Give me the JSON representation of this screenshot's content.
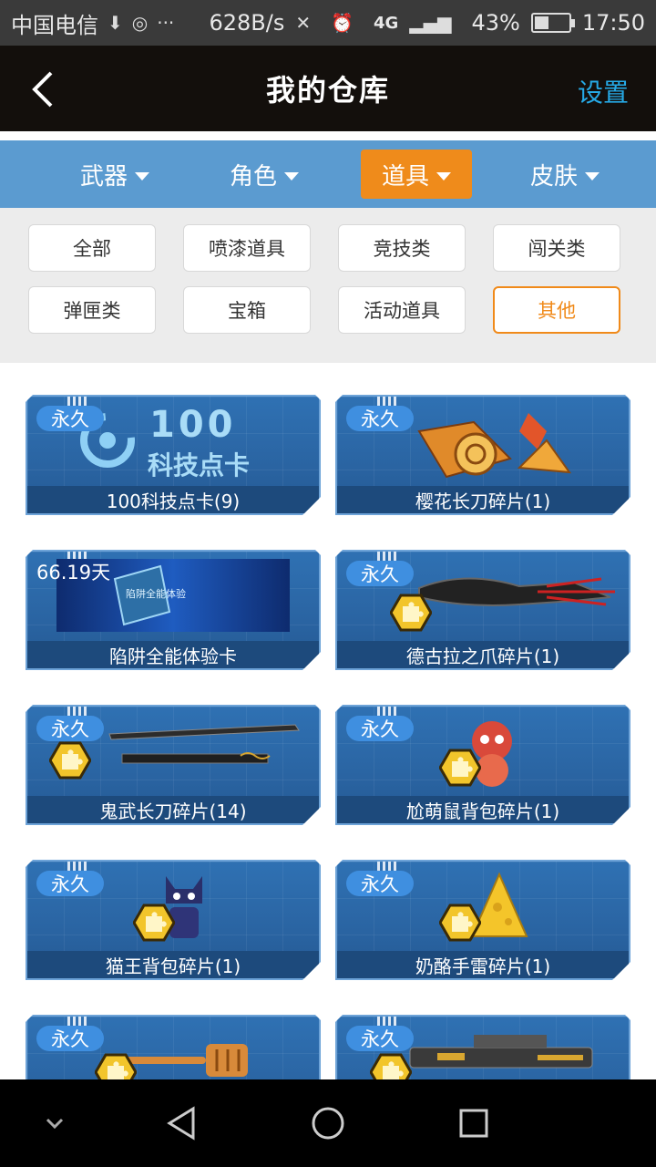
{
  "status_bar": {
    "carrier": "中国电信",
    "speed": "628B/s",
    "network": "4G",
    "battery": "43%",
    "battery_level": 0.43,
    "time": "17:50"
  },
  "header": {
    "title": "我的仓库",
    "settings_label": "设置"
  },
  "categories": [
    {
      "label": "武器",
      "active": false
    },
    {
      "label": "角色",
      "active": false
    },
    {
      "label": "道具",
      "active": true
    },
    {
      "label": "皮肤",
      "active": false
    }
  ],
  "filters": [
    {
      "label": "全部",
      "active": false
    },
    {
      "label": "喷漆道具",
      "active": false
    },
    {
      "label": "竞技类",
      "active": false
    },
    {
      "label": "闯关类",
      "active": false
    },
    {
      "label": "弹匣类",
      "active": false
    },
    {
      "label": "宝箱",
      "active": false
    },
    {
      "label": "活动道具",
      "active": false
    },
    {
      "label": "其他",
      "active": true
    }
  ],
  "items": [
    {
      "badge": "永久",
      "name": "100科技点卡(9)",
      "art_text": "100",
      "art_subtext": "科技点卡"
    },
    {
      "badge": "永久",
      "name": "樱花长刀碎片(1)"
    },
    {
      "badge": "66.19天",
      "name": "陷阱全能体验卡",
      "art_text": "陷阱全能体验"
    },
    {
      "badge": "永久",
      "name": "德古拉之爪碎片(1)"
    },
    {
      "badge": "永久",
      "name": "鬼武长刀碎片(14)"
    },
    {
      "badge": "永久",
      "name": "尬萌鼠背包碎片(1)"
    },
    {
      "badge": "永久",
      "name": "猫王背包碎片(1)"
    },
    {
      "badge": "永久",
      "name": "奶酪手雷碎片(1)"
    },
    {
      "badge": "永久",
      "name": ""
    },
    {
      "badge": "永久",
      "name": ""
    }
  ],
  "colors": {
    "accent": "#ef8b1b",
    "header_bg": "#130f0c",
    "tab_bar": "#5b9bd0",
    "card_blue": "#2a64a2",
    "settings_link": "#26a9e6"
  }
}
